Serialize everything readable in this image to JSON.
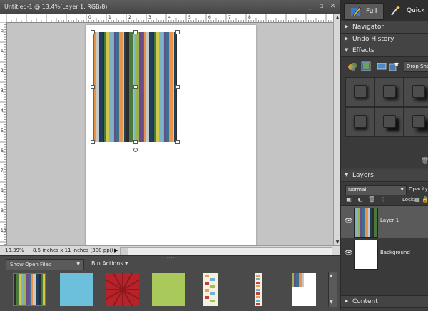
{
  "document": {
    "title": "Untitled-1 @ 13.4%(Layer 1, RGB/8)",
    "zoom": "13.39%",
    "info": "8.5 inches x 11 inches (300 ppi)",
    "ruler_top_labels": [
      "0",
      "1",
      "2",
      "3",
      "4",
      "5",
      "6",
      "7",
      "8"
    ],
    "ruler_left_labels": [
      "0",
      "1",
      "2",
      "3",
      "4",
      "5",
      "6",
      "7",
      "8",
      "9",
      "10"
    ],
    "window_buttons": [
      "_",
      "▫",
      "✕"
    ]
  },
  "bin": {
    "show_open_files": "Show Open Files",
    "bin_actions": "Bin Actions",
    "thumbnails": [
      "stripes",
      "blue",
      "red-burst",
      "green",
      "collage",
      "strip",
      "stripes-page"
    ]
  },
  "modes": {
    "full": "Full",
    "quick": "Quick"
  },
  "panels": {
    "navigator": "Navigator",
    "undo_history": "Undo History",
    "effects": "Effects",
    "effects_dropdown": "Drop Sha",
    "layers": "Layers",
    "content": "Content"
  },
  "layers": {
    "blend_mode": "Normal",
    "opacity_label": "Opacity:",
    "lock_label": "Lock:",
    "items": [
      {
        "name": "Layer 1",
        "selected": true
      },
      {
        "name": "Background",
        "selected": false
      }
    ]
  },
  "colors": {
    "stripes": [
      "#3b6e8f",
      "#7fb3c8",
      "#2c2c2c",
      "#e6944a",
      "#9ab34a",
      "#4a7a3a",
      "#c8c8c8",
      "#6a4c8a",
      "#d0c64a",
      "#1f3f5c"
    ],
    "selected_layer": "#555"
  }
}
